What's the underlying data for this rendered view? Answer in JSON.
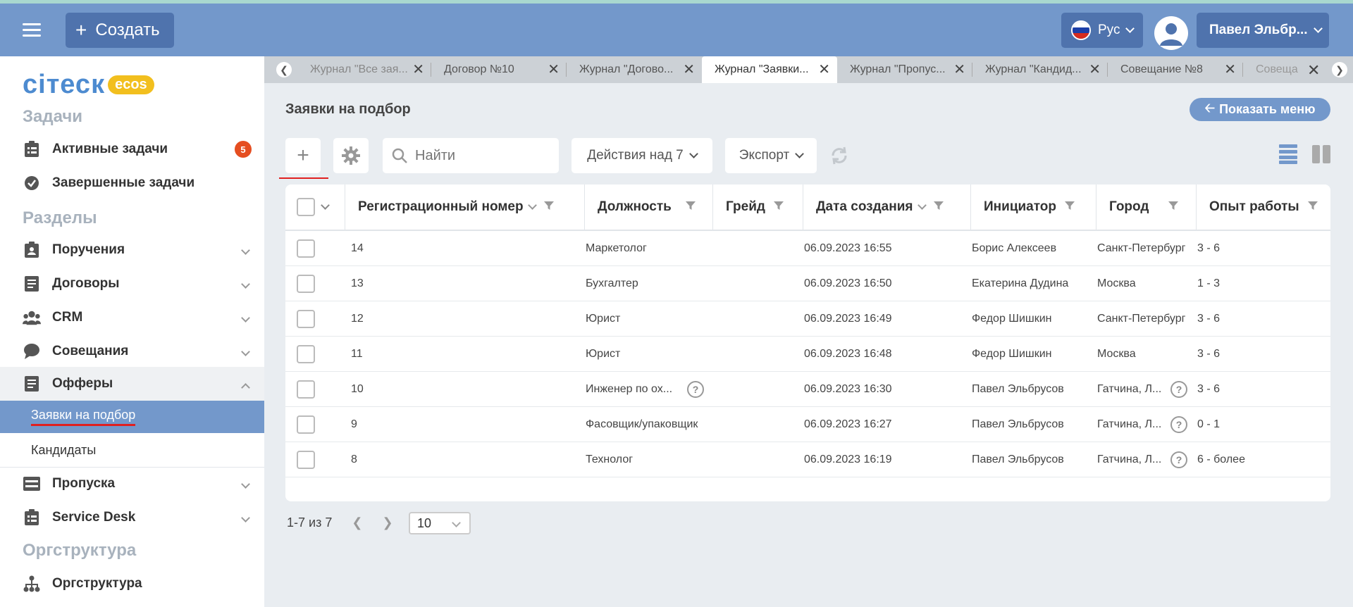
{
  "header": {
    "create_label": "Создать",
    "lang_label": "Рус",
    "user_label": "Павел Эльбр...",
    "colors": {
      "header_bg": "#7398cb",
      "button_bg": "#4f73ad"
    }
  },
  "logo": {
    "text": "сітеск",
    "badge": "ecos"
  },
  "sidebar": {
    "sections": {
      "tasks": "Задачи",
      "sections": "Разделы",
      "org": "Оргструктура"
    },
    "items": {
      "active_tasks": {
        "label": "Активные задачи",
        "badge": "5"
      },
      "done_tasks": {
        "label": "Завершенные задачи"
      },
      "orders": {
        "label": "Поручения"
      },
      "contracts": {
        "label": "Договоры"
      },
      "crm": {
        "label": "CRM"
      },
      "meetings": {
        "label": "Совещания"
      },
      "offers": {
        "label": "Офферы"
      },
      "requests": {
        "label": "Заявки на подбор"
      },
      "candidates": {
        "label": "Кандидаты"
      },
      "passes": {
        "label": "Пропуска"
      },
      "service_desk": {
        "label": "Service Desk"
      },
      "orgstructure": {
        "label": "Оргструктура"
      }
    }
  },
  "tabs": [
    {
      "label": "Журнал \"Все зая..."
    },
    {
      "label": "Договор №10"
    },
    {
      "label": "Журнал \"Догово..."
    },
    {
      "label": "Журнал \"Заявки...",
      "active": true
    },
    {
      "label": "Журнал \"Пропус..."
    },
    {
      "label": "Журнал \"Кандид..."
    },
    {
      "label": "Совещание №8"
    },
    {
      "label": "Совеща"
    }
  ],
  "page": {
    "title": "Заявки на подбор",
    "show_menu": "Показать меню"
  },
  "toolbar": {
    "search_placeholder": "Найти",
    "actions_label": "Действия над 7",
    "export_label": "Экспорт"
  },
  "table": {
    "columns": {
      "reg": "Регистрационный номер",
      "position": "Должность",
      "grade": "Грейд",
      "date": "Дата создания",
      "initiator": "Инициатор",
      "city": "Город",
      "experience": "Опыт работы"
    },
    "rows": [
      {
        "reg": "14",
        "position": "Маркетолог",
        "date": "06.09.2023 16:55",
        "initiator": "Борис Алексеев",
        "city": "Санкт-Петербург",
        "experience": "3 - 6"
      },
      {
        "reg": "13",
        "position": "Бухгалтер",
        "date": "06.09.2023 16:50",
        "initiator": "Екатерина Дудина",
        "city": "Москва",
        "experience": "1 - 3"
      },
      {
        "reg": "12",
        "position": "Юрист",
        "date": "06.09.2023 16:49",
        "initiator": "Федор Шишкин",
        "city": "Санкт-Петербург",
        "experience": "3 - 6"
      },
      {
        "reg": "11",
        "position": "Юрист",
        "date": "06.09.2023 16:48",
        "initiator": "Федор Шишкин",
        "city": "Москва",
        "experience": "3 - 6"
      },
      {
        "reg": "10",
        "position": "Инженер по ох...",
        "date": "06.09.2023 16:30",
        "initiator": "Павел Эльбрусов",
        "city": "Гатчина, Л...",
        "experience": "3 - 6",
        "pos_help": true,
        "city_help": true
      },
      {
        "reg": "9",
        "position": "Фасовщик/упаковщик",
        "date": "06.09.2023 16:27",
        "initiator": "Павел Эльбрусов",
        "city": "Гатчина, Л...",
        "experience": "0 - 1",
        "city_help": true
      },
      {
        "reg": "8",
        "position": "Технолог",
        "date": "06.09.2023 16:19",
        "initiator": "Павел Эльбрусов",
        "city": "Гатчина, Л...",
        "experience": "6 - более",
        "city_help": true
      }
    ]
  },
  "pager": {
    "range": "1-7 из 7",
    "page_size": "10"
  }
}
